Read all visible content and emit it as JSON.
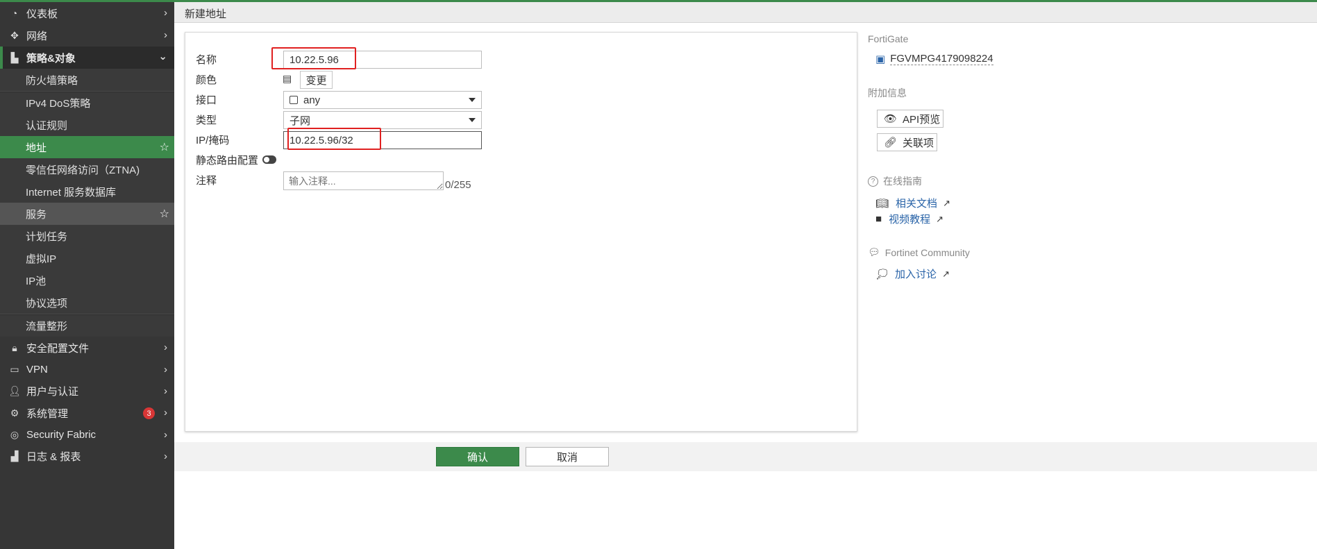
{
  "header": {
    "title": "新建地址"
  },
  "sidebar": {
    "items": [
      {
        "label": "仪表板",
        "icon": "dashboard-icon"
      },
      {
        "label": "网络",
        "icon": "network-icon"
      },
      {
        "label": "策略&对象",
        "icon": "policy-icon"
      }
    ],
    "subitems": [
      "防火墙策略",
      "IPv4 DoS策略",
      "认证规则",
      "地址",
      "零信任网络访问（ZTNA)",
      "Internet 服务数据库",
      "服务",
      "计划任务",
      "虚拟IP",
      "IP池",
      "协议选项",
      "流量整形"
    ],
    "items2": [
      {
        "label": "安全配置文件",
        "icon": "lock-icon"
      },
      {
        "label": "VPN",
        "icon": "laptop-icon"
      },
      {
        "label": "用户与认证",
        "icon": "user-icon"
      },
      {
        "label": "系统管理",
        "icon": "gear-icon",
        "badge": "3"
      },
      {
        "label": "Security Fabric",
        "icon": "fabric-icon"
      },
      {
        "label": "日志 & 报表",
        "icon": "chart-icon"
      }
    ]
  },
  "form": {
    "name_label": "名称",
    "name_value": "10.22.5.96",
    "color_label": "颜色",
    "color_button": "变更",
    "interface_label": "接口",
    "interface_value": "any",
    "type_label": "类型",
    "type_value": "子网",
    "ip_label": "IP/掩码",
    "ip_value": "10.22.5.96/32",
    "static_route_label": "静态路由配置",
    "comment_label": "注释",
    "comment_placeholder": "输入注释...",
    "comment_count": "0/255"
  },
  "actions": {
    "ok": "确认",
    "cancel": "取消"
  },
  "right_panel": {
    "device_heading": "FortiGate",
    "device_name": "FGVMPG4179098224",
    "extra_heading": "附加信息",
    "api_preview": "API预览",
    "references": "关联项",
    "guide_heading": "在线指南",
    "docs_link": "相关文档",
    "video_link": "视频教程",
    "community_heading": "Fortinet Community",
    "discussion_link": "加入讨论"
  },
  "colors": {
    "accent": "#3c8a4b",
    "sidebar": "#363636",
    "link": "#2a64a8",
    "highlight_box": "#e02020"
  }
}
